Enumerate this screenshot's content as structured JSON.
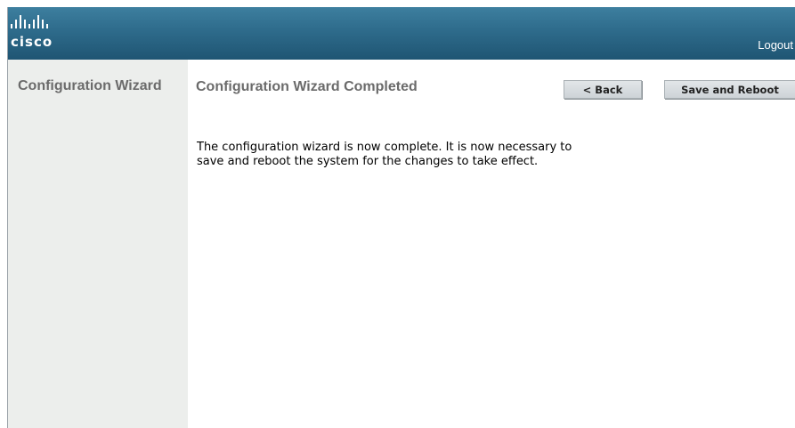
{
  "header": {
    "logo_text": "cisco",
    "logout_label": "Logout",
    "brand_color": "#2e6b8b"
  },
  "sidebar": {
    "title": "Configuration Wizard"
  },
  "main": {
    "title": "Configuration Wizard Completed",
    "back_label": "< Back",
    "save_reboot_label": "Save and Reboot",
    "message": "The configuration wizard is now complete. It is now necessary to save and reboot the system for the changes to take effect."
  },
  "icons": {
    "logo": "cisco-bridge-logo-icon"
  }
}
